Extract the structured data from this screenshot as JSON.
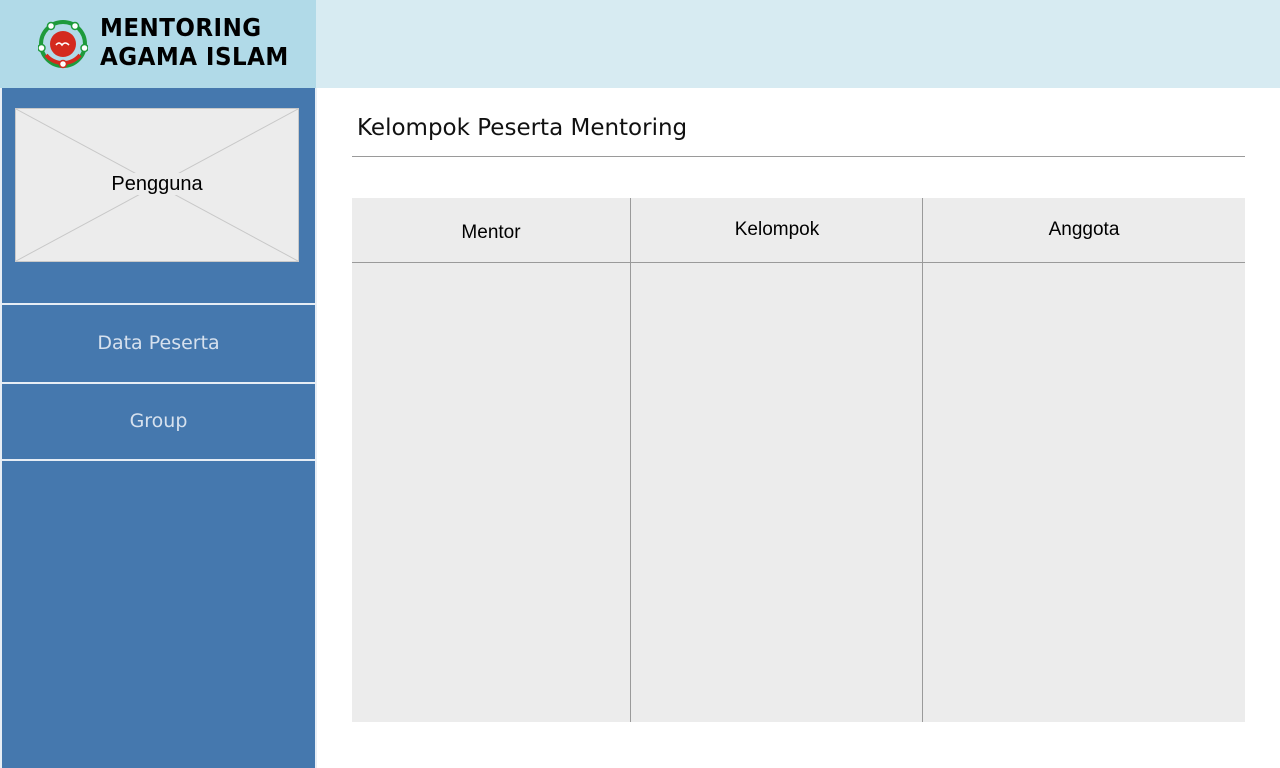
{
  "brand": {
    "line1": "MENTORING",
    "line2": "AGAMA ISLAM",
    "logo_icon": "mentoring-logo-icon",
    "colors": {
      "brand_panel": "#b1dae8",
      "header_bar": "#d7ebf2",
      "logo_green": "#1e9a3c",
      "logo_red": "#d42a1e"
    }
  },
  "sidebar": {
    "background": "#4578ae",
    "user_card": {
      "label": "Pengguna",
      "icon": "image-placeholder-icon"
    },
    "items": [
      {
        "label": "Data Peserta"
      },
      {
        "label": "Group"
      }
    ]
  },
  "main": {
    "title": "Kelompok Peserta Mentoring",
    "table": {
      "columns": [
        "Mentor",
        "Kelompok",
        "Anggota"
      ],
      "rows": []
    }
  }
}
